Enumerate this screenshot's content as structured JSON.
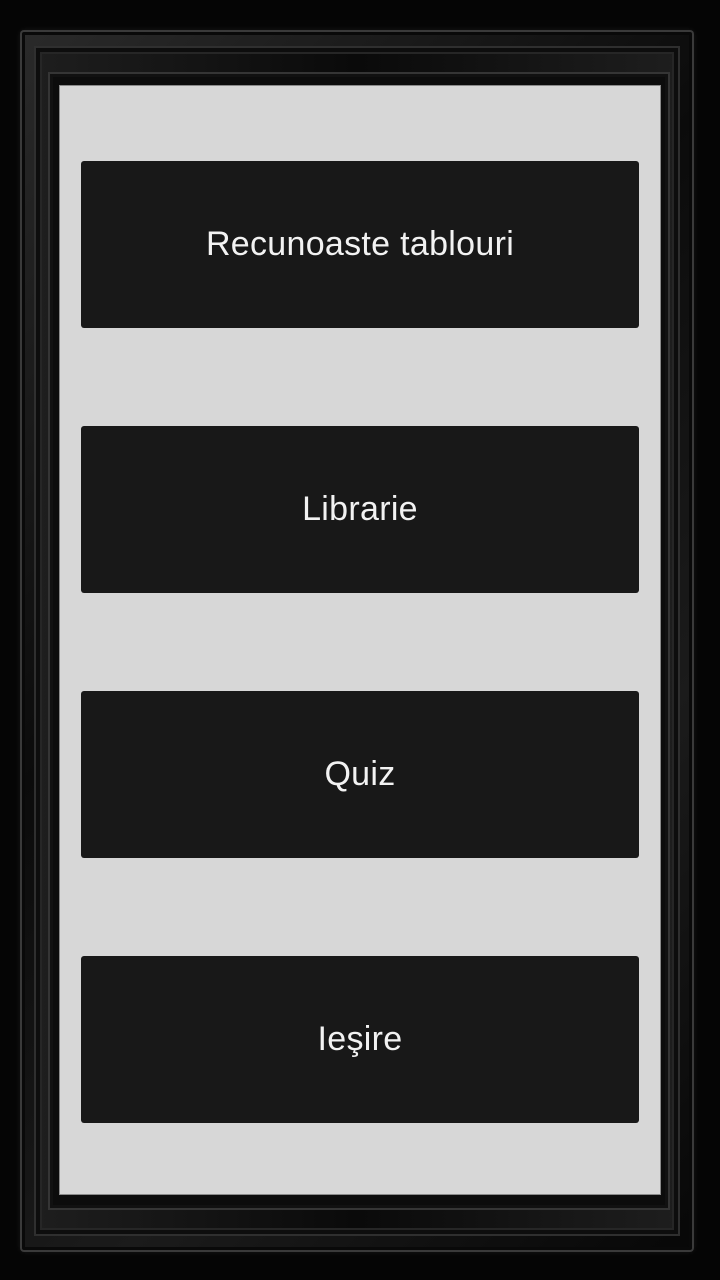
{
  "menu": {
    "buttons": [
      {
        "label": "Recunoaste tablouri"
      },
      {
        "label": "Librarie"
      },
      {
        "label": "Quiz"
      },
      {
        "label": "Ieşire"
      }
    ]
  },
  "colors": {
    "frame": "#050505",
    "canvas_background": "#d7d7d7",
    "button_background": "#181818",
    "button_text": "#f2f2f2"
  }
}
